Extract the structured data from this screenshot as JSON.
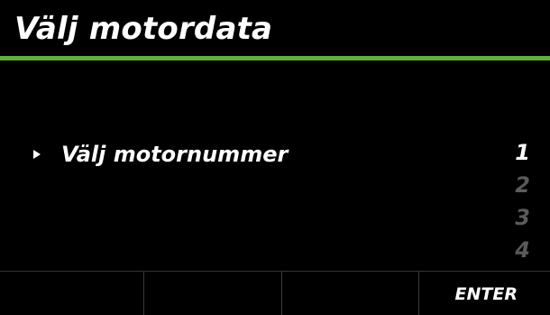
{
  "header": {
    "title": "Välj motordata"
  },
  "menu": {
    "selected_label": "Välj motornummer",
    "selector_icon": "triangle-right-icon",
    "values": [
      {
        "label": "1",
        "state": "selected"
      },
      {
        "label": "2",
        "state": "dim"
      },
      {
        "label": "3",
        "state": "dim"
      },
      {
        "label": "4",
        "state": "dim"
      }
    ]
  },
  "softkeys": {
    "key1": "",
    "key2": "",
    "key3": "",
    "key4": "ENTER"
  },
  "colors": {
    "background": "#000000",
    "text": "#ffffff",
    "accent": "#5cb23a",
    "dim_value": "#5a5a5a"
  }
}
